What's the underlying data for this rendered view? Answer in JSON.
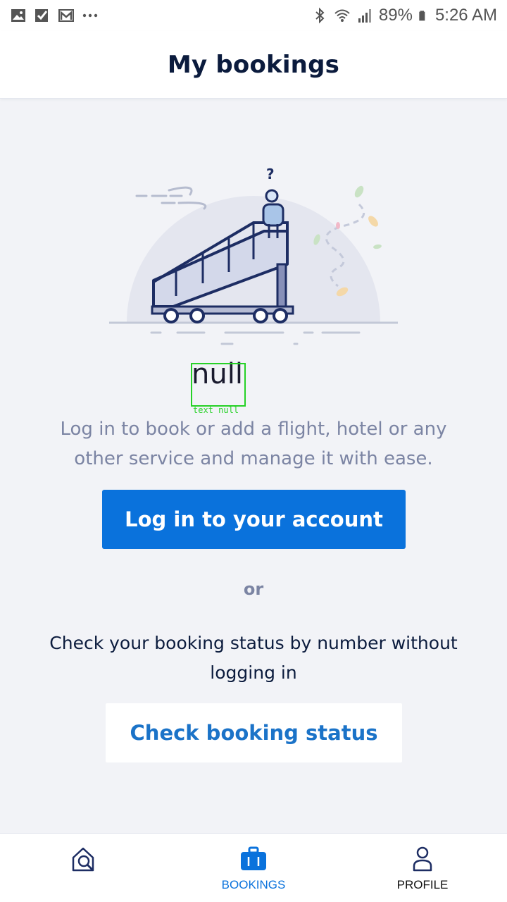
{
  "status_bar": {
    "battery": "89%",
    "time": "5:26 AM",
    "left_icons": [
      "image-icon",
      "check-icon",
      "gmail-icon",
      "more-icon"
    ],
    "right_icons": [
      "bluetooth-icon",
      "wifi-icon",
      "signal-icon",
      "battery-icon"
    ]
  },
  "header": {
    "title": "My bookings"
  },
  "overlay": {
    "text": "null",
    "label": "text null"
  },
  "main": {
    "description": "Log in to book or add a flight, hotel or any other service and manage it with ease.",
    "login_button": "Log in to your account",
    "or_text": "or",
    "check_description": "Check your booking status by number without logging in",
    "check_button": "Check booking status"
  },
  "bottom_nav": {
    "items": [
      {
        "label": "",
        "icon": "search-home-icon"
      },
      {
        "label": "BOOKINGS",
        "icon": "briefcase-icon",
        "active": true
      },
      {
        "label": "PROFILE",
        "icon": "person-icon"
      }
    ]
  },
  "colors": {
    "accent": "#0a72dc",
    "secondary_text": "#7b84a3",
    "primary_text": "#0b1b3d",
    "background": "#f2f3f7"
  }
}
